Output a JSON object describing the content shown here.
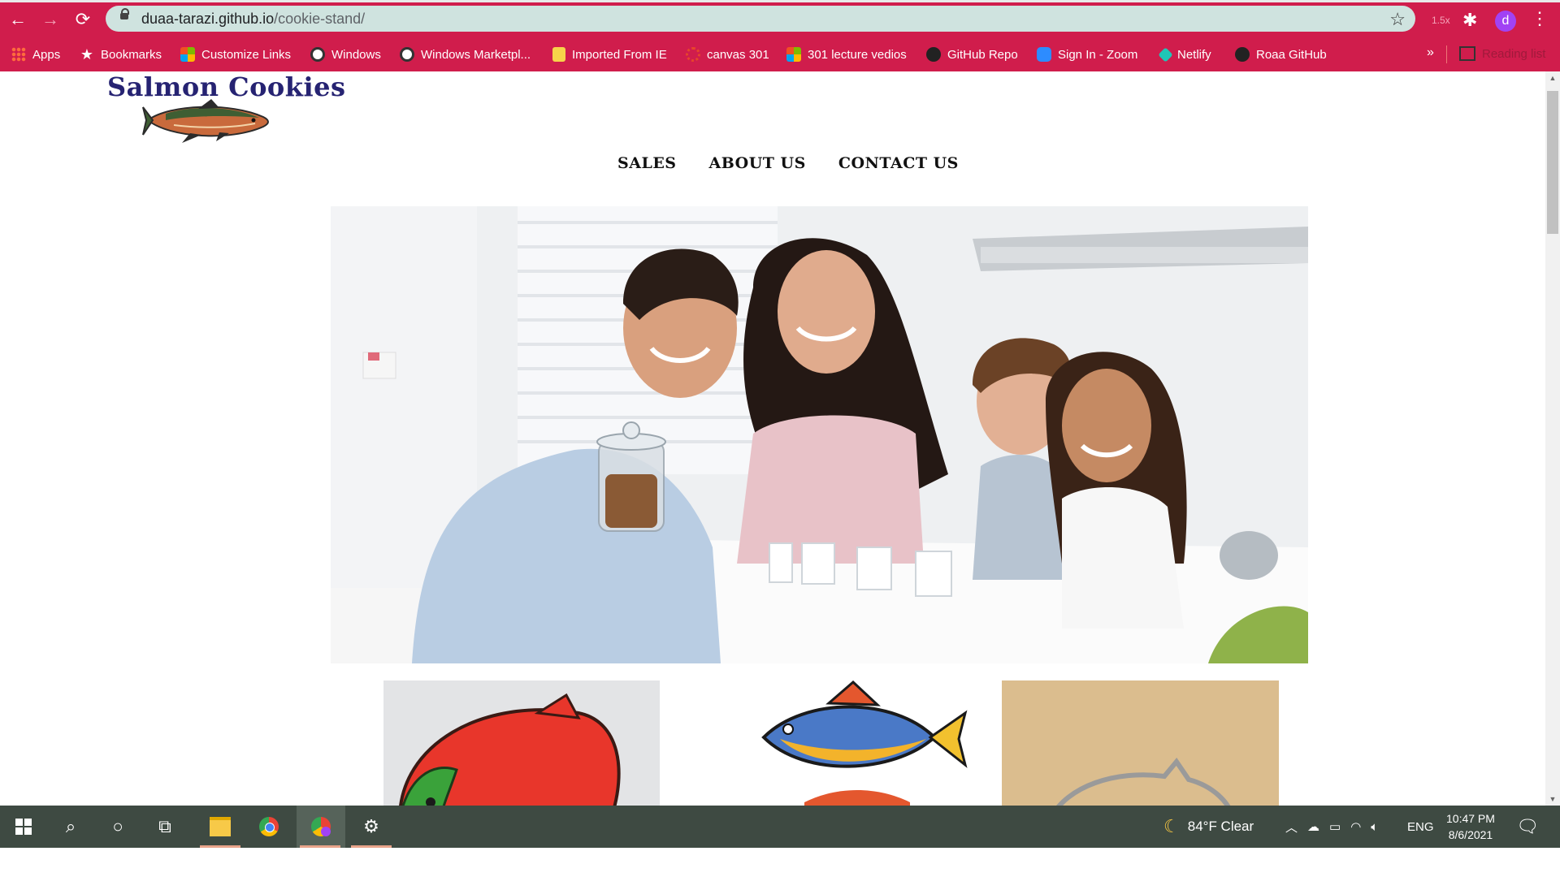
{
  "browser": {
    "url_host": "duaa-tarazi.github.io",
    "url_path": "/cookie-stand/",
    "zoom": "1.5x",
    "profile_initial": "d",
    "accent_color": "#d01d4c",
    "bookmarks": [
      {
        "label": "Apps",
        "icon": "apps-grid-icon"
      },
      {
        "label": "Bookmarks",
        "icon": "star-icon"
      },
      {
        "label": "Customize Links",
        "icon": "microsoft-icon"
      },
      {
        "label": "Windows",
        "icon": "globe-icon"
      },
      {
        "label": "Windows Marketpl...",
        "icon": "globe-icon"
      },
      {
        "label": "Imported From IE",
        "icon": "folder-icon"
      },
      {
        "label": "canvas 301",
        "icon": "canvas-icon"
      },
      {
        "label": "301 lecture vedios",
        "icon": "microsoft-icon"
      },
      {
        "label": "GitHub Repo",
        "icon": "github-icon"
      },
      {
        "label": "Sign In - Zoom",
        "icon": "zoom-icon"
      },
      {
        "label": "Netlify",
        "icon": "netlify-icon"
      },
      {
        "label": "Roaa GitHub",
        "icon": "github-icon"
      }
    ],
    "more_label": "»",
    "reading_list": "Reading list"
  },
  "site": {
    "title": "Salmon Cookies",
    "nav": [
      "SALES",
      "ABOUT US",
      "CONTACT US"
    ]
  },
  "taskbar": {
    "weather": "84°F  Clear",
    "language": "ENG",
    "time": "10:47 PM",
    "date": "8/6/2021"
  }
}
